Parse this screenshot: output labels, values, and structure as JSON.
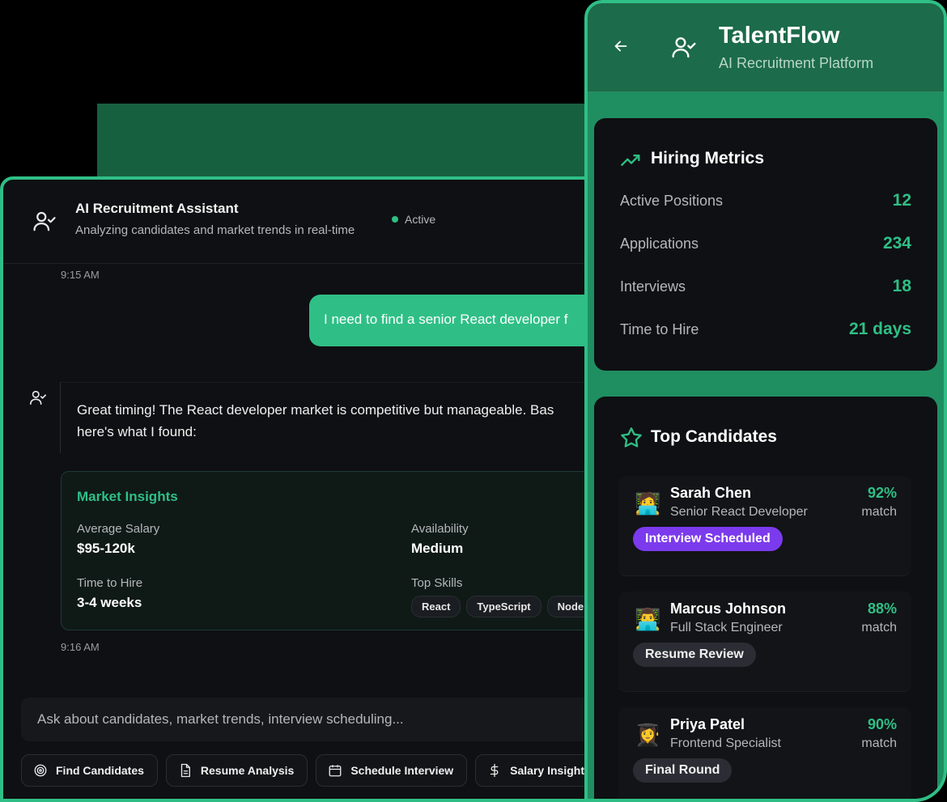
{
  "chat": {
    "title": "AI Recruitment Assistant",
    "subtitle": "Analyzing candidates and market trends in real-time",
    "status": "Active",
    "messages": {
      "time1": "9:15 AM",
      "user_text": "I need to find a senior React developer f",
      "bot_line1": "Great timing! The React developer market is competitive but manageable. Bas",
      "bot_line2": "here's what I found:",
      "time2": "9:16 AM"
    },
    "insights": {
      "title": "Market Insights",
      "avg_salary_label": "Average Salary",
      "avg_salary_value": "$95-120k",
      "availability_label": "Availability",
      "availability_value": "Medium",
      "time_to_hire_label": "Time to Hire",
      "time_to_hire_value": "3-4 weeks",
      "top_skills_label": "Top Skills",
      "skills": [
        "React",
        "TypeScript",
        "Node"
      ]
    },
    "input_placeholder": "Ask about candidates, market trends, interview scheduling...",
    "actions": [
      "Find Candidates",
      "Resume Analysis",
      "Schedule Interview",
      "Salary Insights"
    ]
  },
  "panel": {
    "brand_title": "TalentFlow",
    "brand_subtitle": "AI Recruitment Platform",
    "metrics": {
      "title": "Hiring Metrics",
      "rows": [
        {
          "label": "Active Positions",
          "value": "12"
        },
        {
          "label": "Applications",
          "value": "234"
        },
        {
          "label": "Interviews",
          "value": "18"
        },
        {
          "label": "Time to Hire",
          "value": "21 days"
        }
      ]
    },
    "candidates": {
      "title": "Top Candidates",
      "list": [
        {
          "avatar": "🧑‍💻",
          "name": "Sarah Chen",
          "role": "Senior React Developer",
          "pct": "92%",
          "match": "match",
          "badge": "Interview Scheduled",
          "badge_color": "#7c3aed"
        },
        {
          "avatar": "👨‍💻",
          "name": "Marcus Johnson",
          "role": "Full Stack Engineer",
          "pct": "88%",
          "match": "match",
          "badge": "Resume Review",
          "badge_color": "#2a2d33"
        },
        {
          "avatar": "👩‍🎓",
          "name": "Priya Patel",
          "role": "Frontend Specialist",
          "pct": "90%",
          "match": "match",
          "badge": "Final Round",
          "badge_color": "#2a2d33"
        }
      ]
    }
  },
  "colors": {
    "accent": "#2fbf86",
    "purple": "#7c3aed",
    "header_green": "#1c6b4a"
  }
}
